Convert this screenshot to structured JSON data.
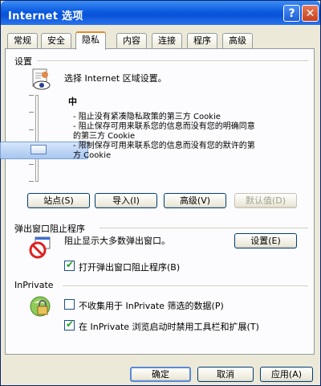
{
  "window": {
    "title": "Internet 选项",
    "help_label": "?",
    "close_label": "✕"
  },
  "tabs": [
    {
      "label": "常规"
    },
    {
      "label": "安全"
    },
    {
      "label": "隐私"
    },
    {
      "label": "内容"
    },
    {
      "label": "连接"
    },
    {
      "label": "程序"
    },
    {
      "label": "高级"
    }
  ],
  "settings": {
    "header": "设置",
    "instruction": "选择 Internet 区域设置。",
    "level": "中",
    "description": [
      "- 阻止没有紧凑隐私政策的第三方 Cookie",
      "- 阻止保存可用来联系您的信息而没有您的明确同意",
      "的第三方 Cookie",
      "- 限制保存可用来联系您的信息而没有您的默许的第",
      "方 Cookie"
    ],
    "buttons": {
      "sites": "站点(S)",
      "import": "导入(I)",
      "advanced": "高级(V)",
      "default": "默认值(D)"
    }
  },
  "popup": {
    "header": "弹出窗口阻止程序",
    "description": "阻止显示大多数弹出窗口。",
    "settings_button": "设置(E)",
    "enable_label": "打开弹出窗口阻止程序(B)",
    "enable_checked": true
  },
  "inprivate": {
    "header": "InPrivate",
    "option1_label": "不收集用于 InPrivate 筛选的数据(P)",
    "option1_checked": false,
    "option2_label": "在 InPrivate 浏览启动时禁用工具栏和扩展(T)",
    "option2_checked": true,
    "check_mark": "✔"
  },
  "footer": {
    "ok": "确定",
    "cancel": "取消",
    "apply": "应用(A)"
  }
}
